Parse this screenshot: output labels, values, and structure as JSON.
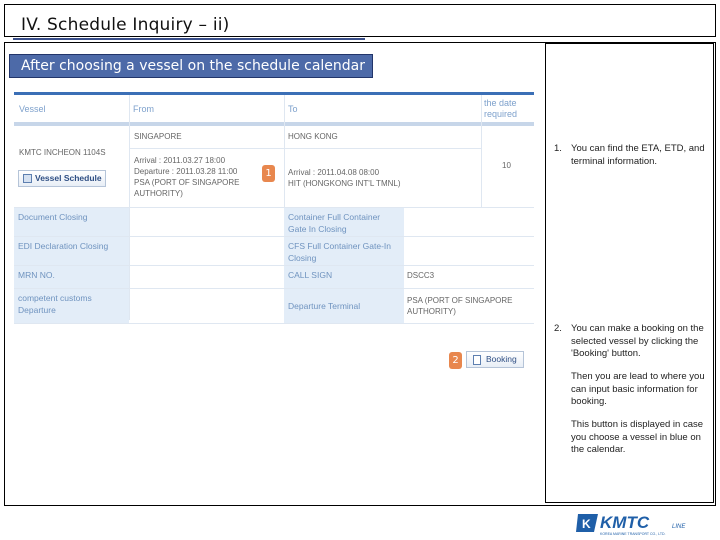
{
  "slide": {
    "title": "IV. Schedule Inquiry – ii)",
    "subtitle": "After choosing a vessel on the schedule calendar"
  },
  "table": {
    "headers": {
      "vessel": "Vessel",
      "from": "From",
      "to": "To",
      "date_required": "the date required"
    },
    "vessel_name": "KMTC INCHEON 1104S",
    "vessel_schedule_button": "Vessel Schedule",
    "from_port": "SINGAPORE",
    "to_port": "HONG KONG",
    "from_detail": "Arrival : 2011.03.27 18:00\nDeparture : 2011.03.28 11:00\nPSA (PORT OF SINGAPORE AUTHORITY)",
    "to_detail": "Arrival : 2011.04.08 08:00\nHIT (HONGKONG INT'L TMNL)",
    "days": "10",
    "rows": {
      "document_closing": "Document Closing",
      "container_closing": "Container Full Container Gate In Closing",
      "edi_closing": "EDI Declaration Closing",
      "cfs_closing": "CFS Full Container Gate-In Closing",
      "mrn": "MRN NO.",
      "call_sign": "CALL SIGN",
      "call_sign_value": "DSCC3",
      "customs_departure": "competent customs Departure",
      "departure_terminal": "Departure Terminal",
      "departure_terminal_value": "PSA (PORT OF SINGAPORE AUTHORITY)"
    },
    "booking_button": "Booking"
  },
  "markers": {
    "one": "1",
    "two": "2"
  },
  "notes": {
    "item1_num": "1.",
    "item1_text": "You can find the ETA, ETD, and terminal information.",
    "item2_num": "2.",
    "item2_text": "You can make a booking on the selected vessel by clicking the 'Booking' button.",
    "item2_sub1": "Then you are lead to where you can input basic information for booking.",
    "item2_sub2": "This button is displayed in case you choose a vessel in blue on the calendar."
  },
  "logo": {
    "brand": "KMTC",
    "suffix": "LINE",
    "tagline": "KOREA MARINE TRANSPORT CO., LTD."
  },
  "colors": {
    "banner": "#4d6aa8",
    "marker": "#e8874e",
    "header_blue": "#3b6fb6",
    "label_bg": "#e3edf8"
  }
}
